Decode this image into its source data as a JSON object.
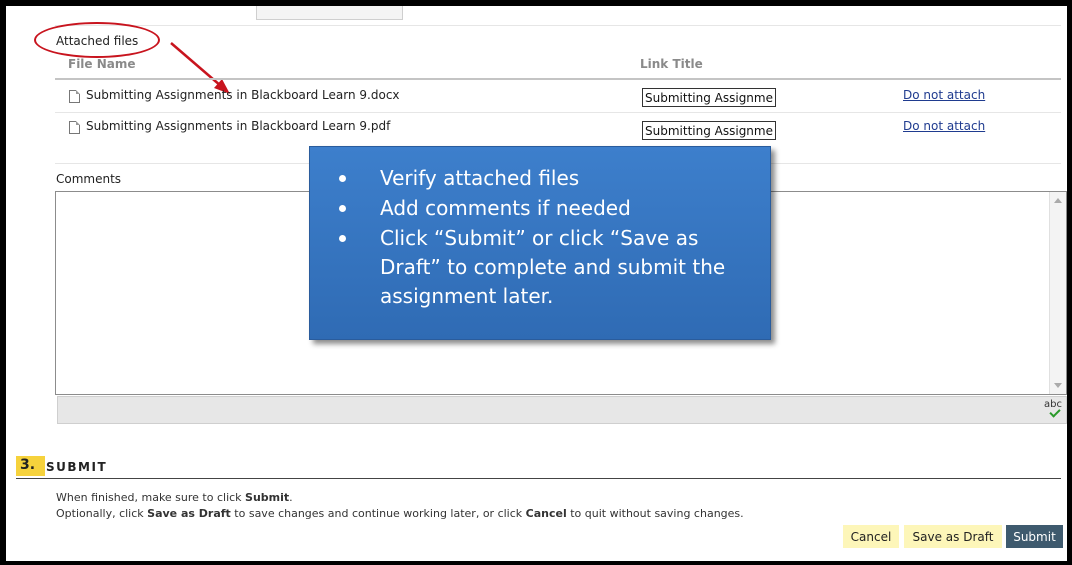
{
  "attached_files": {
    "heading": "Attached files",
    "col_file_name": "File Name",
    "col_link_title": "Link Title",
    "rows": [
      {
        "file_name": "Submitting Assignments in Blackboard Learn 9.docx",
        "link_title": "Submitting Assignmen",
        "action": "Do not attach"
      },
      {
        "file_name": "Submitting Assignments in Blackboard Learn 9.pdf",
        "link_title": "Submitting Assignmen",
        "action": "Do not attach"
      }
    ]
  },
  "callout": {
    "items": [
      "Verify attached files",
      "Add comments if needed",
      "Click “Submit” or click “Save as Draft” to complete and submit the assignment later."
    ],
    "color": "#3a78c6"
  },
  "comments": {
    "label": "Comments",
    "spellcheck_label": "abc"
  },
  "submit_section": {
    "step_number": "3.",
    "title": "SUBMIT",
    "line1_pre": "When finished, make sure to click ",
    "line1_bold": "Submit",
    "line1_post": ".",
    "line2_a": "Optionally, click ",
    "line2_b": "Save as Draft",
    "line2_c": " to save changes and continue working later, or click ",
    "line2_d": "Cancel",
    "line2_e": " to quit without saving changes."
  },
  "buttons": {
    "cancel": "Cancel",
    "save_draft": "Save as Draft",
    "submit": "Submit"
  },
  "colors": {
    "step_badge": "#f6d23c",
    "annotation": "#c8141e",
    "submit_button": "#3e5a6e",
    "secondary_button": "#fdf6b9"
  }
}
